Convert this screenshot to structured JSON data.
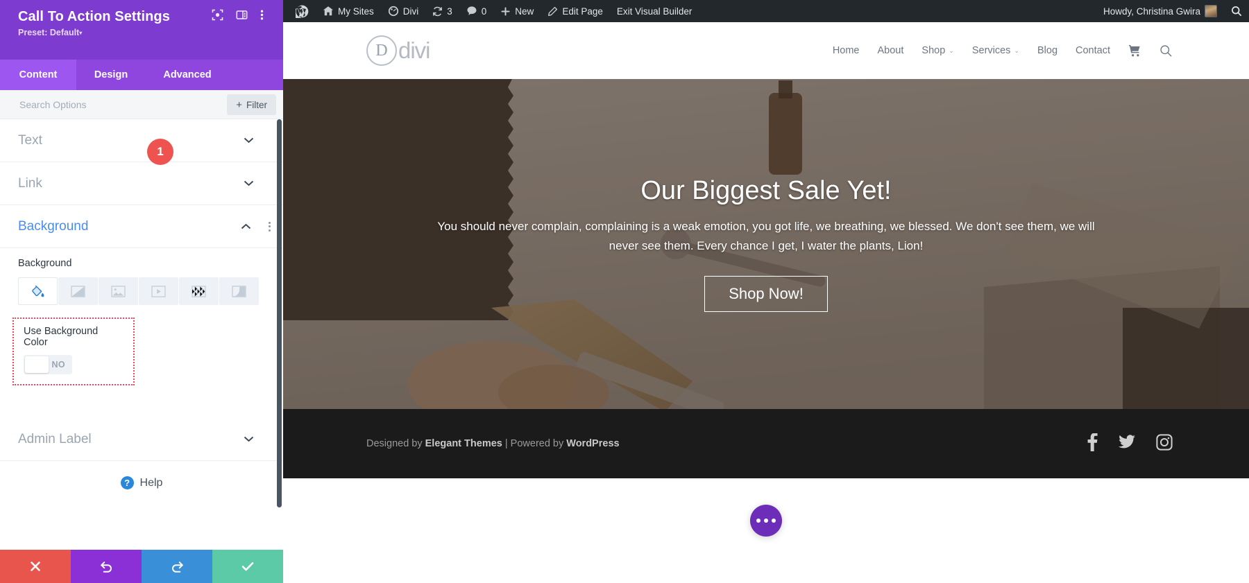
{
  "panel": {
    "title": "Call To Action Settings",
    "preset_label": "Preset: Default",
    "preset_caret": "▾",
    "header_icons": [
      {
        "name": "focus-icon"
      },
      {
        "name": "layout-panel-icon"
      },
      {
        "name": "kebab-menu-icon"
      }
    ],
    "tabs": [
      {
        "label": "Content",
        "active": true
      },
      {
        "label": "Design",
        "active": false
      },
      {
        "label": "Advanced",
        "active": false
      }
    ],
    "search": {
      "placeholder": "Search Options",
      "value": ""
    },
    "filter_button": {
      "label": "Filter",
      "plus": "+"
    },
    "sections": [
      {
        "title": "Text",
        "open": false
      },
      {
        "title": "Link",
        "open": false
      },
      {
        "title": "Background",
        "open": true
      },
      {
        "title": "Admin Label",
        "open": false
      }
    ],
    "background": {
      "field_label": "Background",
      "types": [
        {
          "name": "background-color-tab",
          "label": "Color",
          "active": true
        },
        {
          "name": "background-gradient-tab",
          "label": "Gradient",
          "active": false
        },
        {
          "name": "background-image-tab",
          "label": "Image",
          "active": false
        },
        {
          "name": "background-video-tab",
          "label": "Video",
          "active": false
        },
        {
          "name": "background-pattern-tab",
          "label": "Pattern",
          "active": false
        },
        {
          "name": "background-mask-tab",
          "label": "Mask",
          "active": false
        }
      ],
      "toggle": {
        "label": "Use Background Color",
        "state": "NO",
        "on": false
      },
      "annotation_badge": "1"
    },
    "help": {
      "label": "Help",
      "icon_char": "?"
    },
    "actions": [
      {
        "name": "cancel-button",
        "icon": "close-icon",
        "color": "#e8554d"
      },
      {
        "name": "undo-button",
        "icon": "undo-icon",
        "color": "#8b2fd6"
      },
      {
        "name": "redo-button",
        "icon": "redo-icon",
        "color": "#3a8fd9"
      },
      {
        "name": "save-button",
        "icon": "check-icon",
        "color": "#5cc9a7"
      }
    ],
    "colors": {
      "header_purple": "#7e3bd0",
      "tabbar_purple": "#8f46df",
      "active_tab_purple": "#9d56ef",
      "accent_blue": "#4a8ee8",
      "annotation_red": "#e8485f"
    }
  },
  "adminbar": {
    "items": [
      {
        "name": "wordpress-logo-icon",
        "label": "",
        "icon": "wordpress"
      },
      {
        "name": "my-sites-menu",
        "label": "My Sites",
        "icon": "sites"
      },
      {
        "name": "divi-menu",
        "label": "Divi",
        "icon": "divi"
      },
      {
        "name": "updates-menu",
        "label": "3",
        "icon": "updates"
      },
      {
        "name": "comments-menu",
        "label": "0",
        "icon": "comments"
      },
      {
        "name": "new-content-menu",
        "label": "New",
        "icon": "plus"
      },
      {
        "name": "edit-page-link",
        "label": "Edit Page",
        "icon": "pencil"
      },
      {
        "name": "exit-visual-builder-link",
        "label": "Exit Visual Builder",
        "icon": ""
      }
    ],
    "howdy": "Howdy, Christina Gwira",
    "search_icon": "search-icon"
  },
  "site": {
    "logo": {
      "mark": "D",
      "text": "divi"
    },
    "nav": [
      {
        "label": "Home",
        "dropdown": false
      },
      {
        "label": "About",
        "dropdown": false
      },
      {
        "label": "Shop",
        "dropdown": true
      },
      {
        "label": "Services",
        "dropdown": true
      },
      {
        "label": "Blog",
        "dropdown": false
      },
      {
        "label": "Contact",
        "dropdown": false
      }
    ],
    "nav_caret": "⌄",
    "cart_icon": "cart-icon",
    "search_icon": "search-icon",
    "hero": {
      "title": "Our Biggest Sale Yet!",
      "subtitle": "You should never complain, complaining is a weak emotion, you got life, we breathing, we blessed. We don't see them, we will never see them. Every chance I get, I water the plants, Lion!",
      "button": "Shop Now!"
    },
    "footer": {
      "prefix": "Designed by ",
      "brand1": "Elegant Themes",
      "separator": " | ",
      "middle": "Powered by ",
      "brand2": "WordPress",
      "social": [
        "facebook-icon",
        "twitter-icon",
        "instagram-icon"
      ]
    },
    "fab": {
      "name": "divi-builder-fab",
      "dots": 3
    }
  }
}
